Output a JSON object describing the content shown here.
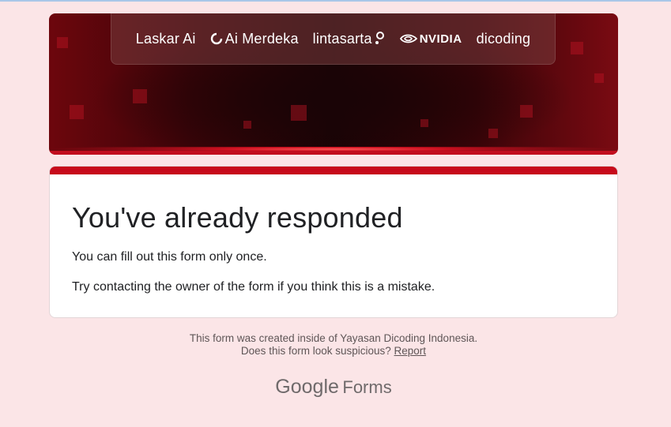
{
  "banner": {
    "logos": [
      "Laskar Ai",
      "Ai Merdeka",
      "lintasarta",
      "NVIDIA",
      "dicoding"
    ]
  },
  "card": {
    "title": "You've already responded",
    "line1": "You can fill out this form only once.",
    "line2": "Try contacting the owner of the form if you think this is a mistake."
  },
  "footer": {
    "created_text": "This form was created inside of Yayasan Dicoding Indonesia.",
    "suspicious_text": "Does this form look suspicious?",
    "report_link": "Report"
  },
  "brand": {
    "google": "Google",
    "forms": "Forms"
  },
  "colors": {
    "page_bg": "#fbe5e7",
    "accent": "#c70a1b"
  }
}
